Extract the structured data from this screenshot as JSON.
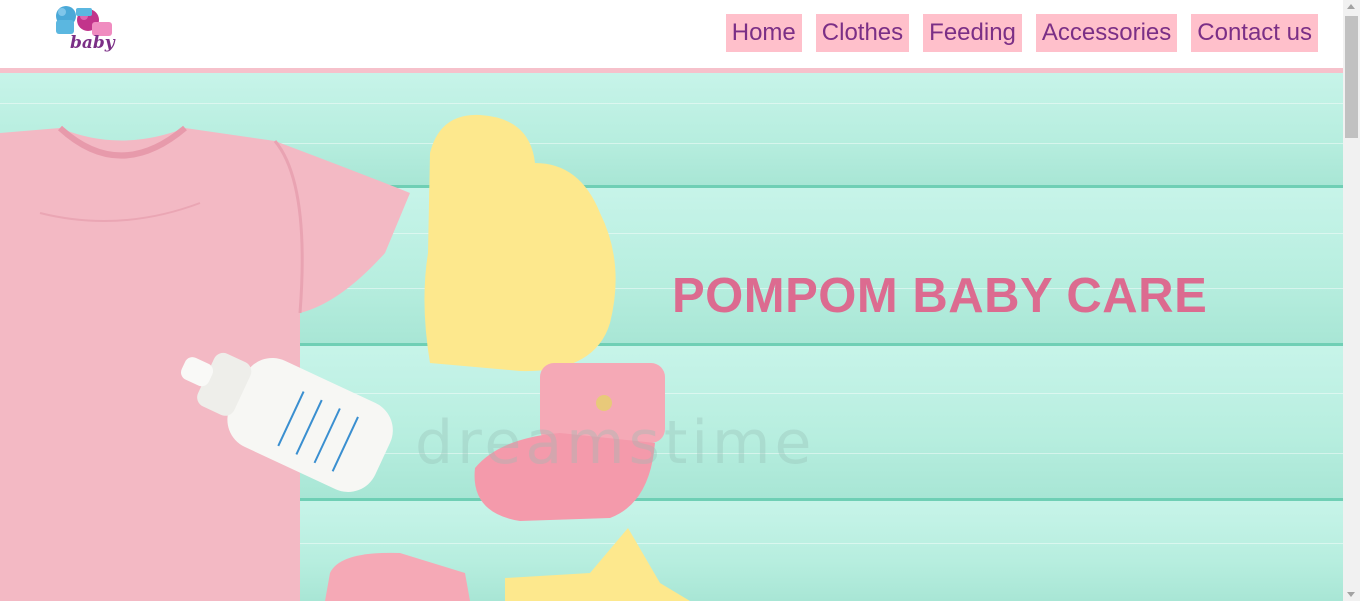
{
  "logo": {
    "text": "baby",
    "icon": "pompom-logo"
  },
  "nav": {
    "items": [
      {
        "label": "Home"
      },
      {
        "label": "Clothes"
      },
      {
        "label": "Feeding"
      },
      {
        "label": "Accessories"
      },
      {
        "label": "Contact us"
      }
    ]
  },
  "hero": {
    "title": "POMPOM BABY CARE",
    "watermark": "dreamstime"
  },
  "colors": {
    "nav_bg": "#ffc0cb",
    "nav_text": "#7b2f86",
    "header_rule": "#f6c1cb",
    "hero_title": "#dc6b90",
    "wood": "#bdf0e3"
  }
}
